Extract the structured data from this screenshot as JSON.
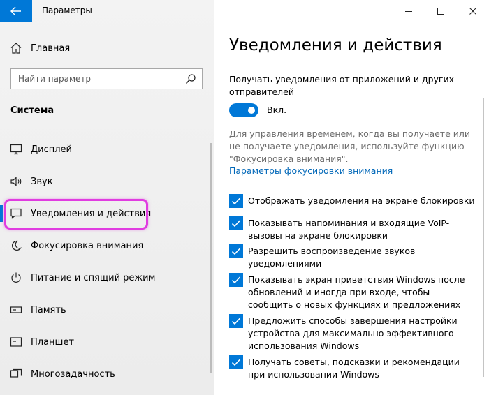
{
  "window": {
    "title": "Параметры"
  },
  "sidebar": {
    "home_label": "Главная",
    "search_placeholder": "Найти параметр",
    "section_title": "Система",
    "items": [
      {
        "label": "Дисплей",
        "icon": "display-icon"
      },
      {
        "label": "Звук",
        "icon": "speaker-icon"
      },
      {
        "label": "Уведомления и действия",
        "icon": "notification-icon",
        "selected": true
      },
      {
        "label": "Фокусировка внимания",
        "icon": "moon-icon"
      },
      {
        "label": "Питание и спящий режим",
        "icon": "power-icon"
      },
      {
        "label": "Память",
        "icon": "storage-icon"
      },
      {
        "label": "Планшет",
        "icon": "tablet-icon"
      },
      {
        "label": "Многозадачность",
        "icon": "multitasking-icon"
      }
    ]
  },
  "main": {
    "title": "Уведомления и действия",
    "notif_label": "Получать уведомления от приложений и других отправителей",
    "toggle_label": "Вкл.",
    "toggle_on": true,
    "description": "Для управления временем, когда вы получаете или не получаете уведомления, используйте функцию \"Фокусировка внимания\".",
    "focus_link": "Параметры фокусировки внимания",
    "checkboxes": [
      {
        "label": "Отображать уведомления на экране блокировки",
        "checked": true
      },
      {
        "label": "Показывать напоминания и входящие VoIP-вызовы на экране блокировки",
        "checked": true
      },
      {
        "label": "Разрешить  воспроизведение звуков уведомлениями",
        "checked": true
      },
      {
        "label": "Показывать экран приветствия Windows после обновлений и иногда при входе, чтобы сообщить о новых функциях и предложениях",
        "checked": true
      },
      {
        "label": "Предложить способы завершения настройки устройства для максимально эффективного использования Windows",
        "checked": true
      },
      {
        "label": "Получать советы, подсказки и рекомендации при использовании Windows",
        "checked": true
      }
    ]
  },
  "colors": {
    "accent": "#0078d7",
    "link": "#0067b8",
    "highlight": "#e03ce0"
  }
}
